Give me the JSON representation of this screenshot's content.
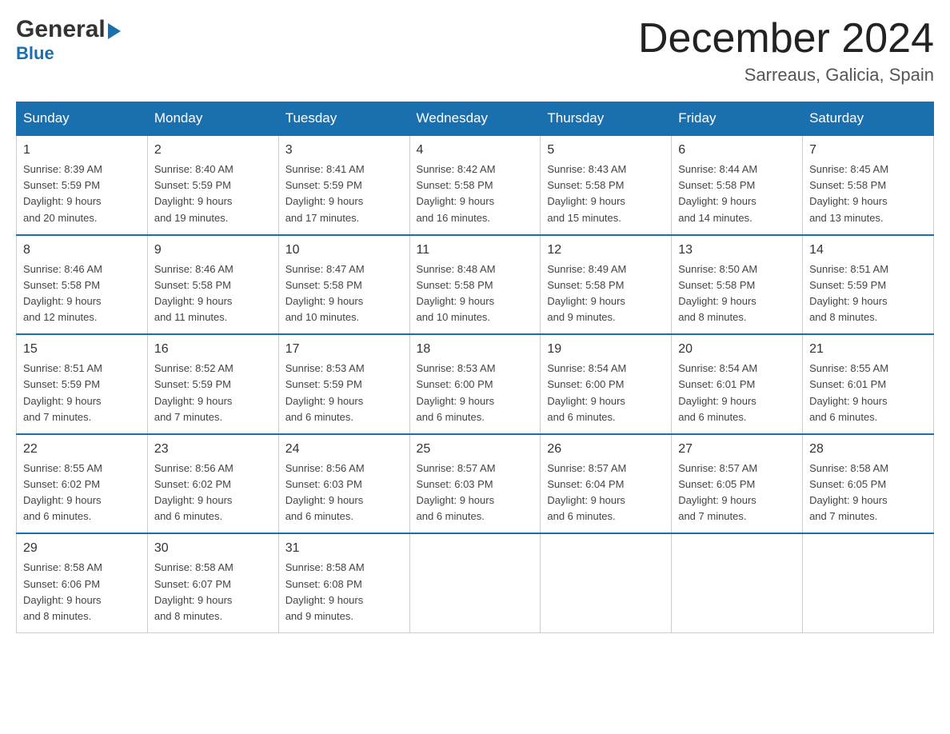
{
  "logo": {
    "general": "General",
    "blue": "Blue"
  },
  "header": {
    "month_year": "December 2024",
    "location": "Sarreaus, Galicia, Spain"
  },
  "days_of_week": [
    "Sunday",
    "Monday",
    "Tuesday",
    "Wednesday",
    "Thursday",
    "Friday",
    "Saturday"
  ],
  "weeks": [
    [
      {
        "day": "1",
        "sunrise": "8:39 AM",
        "sunset": "5:59 PM",
        "daylight": "9 hours and 20 minutes."
      },
      {
        "day": "2",
        "sunrise": "8:40 AM",
        "sunset": "5:59 PM",
        "daylight": "9 hours and 19 minutes."
      },
      {
        "day": "3",
        "sunrise": "8:41 AM",
        "sunset": "5:59 PM",
        "daylight": "9 hours and 17 minutes."
      },
      {
        "day": "4",
        "sunrise": "8:42 AM",
        "sunset": "5:58 PM",
        "daylight": "9 hours and 16 minutes."
      },
      {
        "day": "5",
        "sunrise": "8:43 AM",
        "sunset": "5:58 PM",
        "daylight": "9 hours and 15 minutes."
      },
      {
        "day": "6",
        "sunrise": "8:44 AM",
        "sunset": "5:58 PM",
        "daylight": "9 hours and 14 minutes."
      },
      {
        "day": "7",
        "sunrise": "8:45 AM",
        "sunset": "5:58 PM",
        "daylight": "9 hours and 13 minutes."
      }
    ],
    [
      {
        "day": "8",
        "sunrise": "8:46 AM",
        "sunset": "5:58 PM",
        "daylight": "9 hours and 12 minutes."
      },
      {
        "day": "9",
        "sunrise": "8:46 AM",
        "sunset": "5:58 PM",
        "daylight": "9 hours and 11 minutes."
      },
      {
        "day": "10",
        "sunrise": "8:47 AM",
        "sunset": "5:58 PM",
        "daylight": "9 hours and 10 minutes."
      },
      {
        "day": "11",
        "sunrise": "8:48 AM",
        "sunset": "5:58 PM",
        "daylight": "9 hours and 10 minutes."
      },
      {
        "day": "12",
        "sunrise": "8:49 AM",
        "sunset": "5:58 PM",
        "daylight": "9 hours and 9 minutes."
      },
      {
        "day": "13",
        "sunrise": "8:50 AM",
        "sunset": "5:58 PM",
        "daylight": "9 hours and 8 minutes."
      },
      {
        "day": "14",
        "sunrise": "8:51 AM",
        "sunset": "5:59 PM",
        "daylight": "9 hours and 8 minutes."
      }
    ],
    [
      {
        "day": "15",
        "sunrise": "8:51 AM",
        "sunset": "5:59 PM",
        "daylight": "9 hours and 7 minutes."
      },
      {
        "day": "16",
        "sunrise": "8:52 AM",
        "sunset": "5:59 PM",
        "daylight": "9 hours and 7 minutes."
      },
      {
        "day": "17",
        "sunrise": "8:53 AM",
        "sunset": "5:59 PM",
        "daylight": "9 hours and 6 minutes."
      },
      {
        "day": "18",
        "sunrise": "8:53 AM",
        "sunset": "6:00 PM",
        "daylight": "9 hours and 6 minutes."
      },
      {
        "day": "19",
        "sunrise": "8:54 AM",
        "sunset": "6:00 PM",
        "daylight": "9 hours and 6 minutes."
      },
      {
        "day": "20",
        "sunrise": "8:54 AM",
        "sunset": "6:01 PM",
        "daylight": "9 hours and 6 minutes."
      },
      {
        "day": "21",
        "sunrise": "8:55 AM",
        "sunset": "6:01 PM",
        "daylight": "9 hours and 6 minutes."
      }
    ],
    [
      {
        "day": "22",
        "sunrise": "8:55 AM",
        "sunset": "6:02 PM",
        "daylight": "9 hours and 6 minutes."
      },
      {
        "day": "23",
        "sunrise": "8:56 AM",
        "sunset": "6:02 PM",
        "daylight": "9 hours and 6 minutes."
      },
      {
        "day": "24",
        "sunrise": "8:56 AM",
        "sunset": "6:03 PM",
        "daylight": "9 hours and 6 minutes."
      },
      {
        "day": "25",
        "sunrise": "8:57 AM",
        "sunset": "6:03 PM",
        "daylight": "9 hours and 6 minutes."
      },
      {
        "day": "26",
        "sunrise": "8:57 AM",
        "sunset": "6:04 PM",
        "daylight": "9 hours and 6 minutes."
      },
      {
        "day": "27",
        "sunrise": "8:57 AM",
        "sunset": "6:05 PM",
        "daylight": "9 hours and 7 minutes."
      },
      {
        "day": "28",
        "sunrise": "8:58 AM",
        "sunset": "6:05 PM",
        "daylight": "9 hours and 7 minutes."
      }
    ],
    [
      {
        "day": "29",
        "sunrise": "8:58 AM",
        "sunset": "6:06 PM",
        "daylight": "9 hours and 8 minutes."
      },
      {
        "day": "30",
        "sunrise": "8:58 AM",
        "sunset": "6:07 PM",
        "daylight": "9 hours and 8 minutes."
      },
      {
        "day": "31",
        "sunrise": "8:58 AM",
        "sunset": "6:08 PM",
        "daylight": "9 hours and 9 minutes."
      },
      null,
      null,
      null,
      null
    ]
  ],
  "labels": {
    "sunrise": "Sunrise:",
    "sunset": "Sunset:",
    "daylight": "Daylight:"
  }
}
